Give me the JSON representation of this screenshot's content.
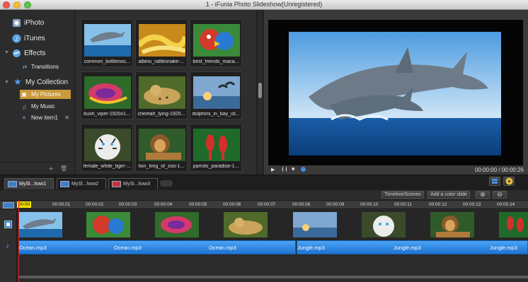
{
  "window": {
    "title": "1 - iFunia Photo Slideshow(Unregistered)"
  },
  "sidebar": {
    "items": [
      {
        "label": "iPhoto",
        "icon": "iphoto-icon"
      },
      {
        "label": "iTunes",
        "icon": "itunes-icon"
      },
      {
        "label": "Effects",
        "icon": "effects-icon"
      },
      {
        "label": "Transitions",
        "icon": "transitions-icon"
      },
      {
        "label": "My Collection",
        "icon": "star-icon"
      },
      {
        "label": "My Pictures",
        "icon": "picture-icon"
      },
      {
        "label": "My Music",
        "icon": "music-note-icon"
      },
      {
        "label": "New item1",
        "icon": "list-icon"
      }
    ],
    "remove_glyph": "✕",
    "add_glyph": "+",
    "trash_glyph": "🗑"
  },
  "browser": {
    "thumbnails": [
      {
        "caption": "common_bottlenos...",
        "subject": "dolphin"
      },
      {
        "caption": "albino_rattlesnake-...",
        "subject": "snake-yellow"
      },
      {
        "caption": "best_friends_maca...",
        "subject": "macaw"
      },
      {
        "caption": "bush_viper-1920x1...",
        "subject": "viper"
      },
      {
        "caption": "cheetah_lying-1920...",
        "subject": "cheetah"
      },
      {
        "caption": "dolphins_in_bay_isl...",
        "subject": "dolphins-sunset"
      },
      {
        "caption": "female_white_tiger-...",
        "subject": "tiger"
      },
      {
        "caption": "lion_king_of_zoo-1...",
        "subject": "lion"
      },
      {
        "caption": "parrots_paradise-1...",
        "subject": "parrots"
      }
    ]
  },
  "preview": {
    "play_glyph": "▶",
    "pause_glyph": "❙❙",
    "stop_glyph": "■",
    "timecode": "00:00:00 / 00:00:26"
  },
  "projects": {
    "tabs": [
      {
        "label": "MySl...how1",
        "active": true
      },
      {
        "label": "MySl...how2",
        "active": false
      },
      {
        "label": "MySl...how3",
        "active": false
      }
    ]
  },
  "timeline": {
    "toolbar": {
      "timeline_scenes": "Timeline/Scenes",
      "add_color_slide": "Add a color slide",
      "zoom_in_glyph": "⊕",
      "zoom_out_glyph": "⊖"
    },
    "playhead_label": "00:00",
    "ruler_ticks": [
      "00:00:01",
      "00:00:02",
      "00:00:03",
      "00:00:04",
      "00:00:05",
      "00:00:06",
      "00:00:07",
      "00:00:08",
      "00:00:09",
      "00:00:10",
      "00:00:11",
      "00:00:12",
      "00:00:13",
      "00:00:14"
    ],
    "video_clips": [
      "dolphin",
      "macaw",
      "viper",
      "cheetah",
      "dolphins-sunset",
      "tiger",
      "lion",
      "parrots"
    ],
    "audio_clips": [
      {
        "label": "Ocean.mp3"
      },
      {
        "label": "Ocean.mp3"
      },
      {
        "label": "Ocean.mp3"
      },
      {
        "label": "Jungle.mp3"
      },
      {
        "label": "Jungle.mp3"
      },
      {
        "label": "Jungle.mp3"
      }
    ]
  }
}
